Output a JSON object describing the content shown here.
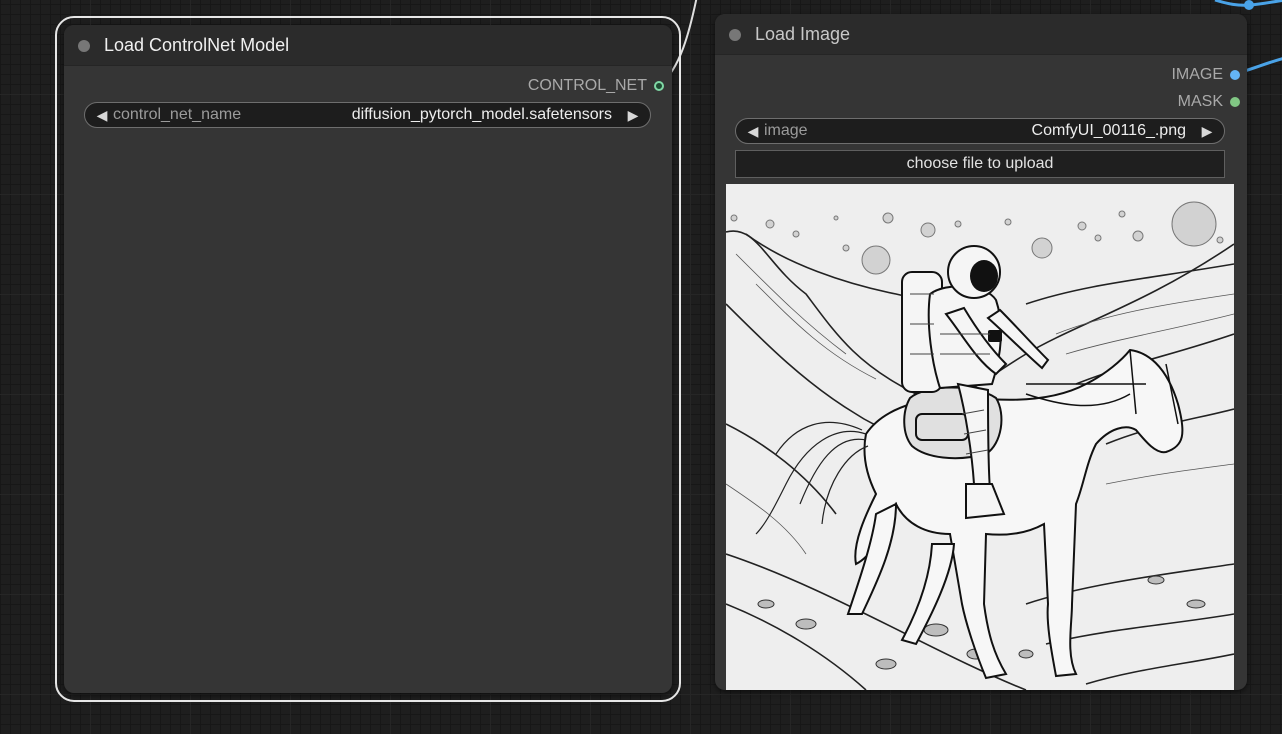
{
  "colors": {
    "canvas_bg": "#1e1e1e",
    "node_bg": "#353535",
    "node_title_bg": "#2b2b2b",
    "control_net_slot": "#7fd8a5",
    "image_slot": "#64b5f6",
    "mask_slot": "#81c784",
    "image_wire": "#4aa3e8",
    "control_wire": "#e0e0e0"
  },
  "nodes": {
    "controlnet_loader": {
      "title": "Load ControlNet Model",
      "output_label": "CONTROL_NET",
      "widget": {
        "name": "control_net_name",
        "value": "diffusion_pytorch_model.safetensors"
      }
    },
    "load_image": {
      "title": "Load Image",
      "outputs": {
        "image": "IMAGE",
        "mask": "MASK"
      },
      "widget": {
        "name": "image",
        "value": "ComfyUI_00116_.png"
      },
      "upload_button": "choose file to upload",
      "preview_subject": "line-art-astronaut-riding-horse"
    }
  },
  "icons": {
    "left_arrow": "◀",
    "right_arrow": "▶"
  }
}
